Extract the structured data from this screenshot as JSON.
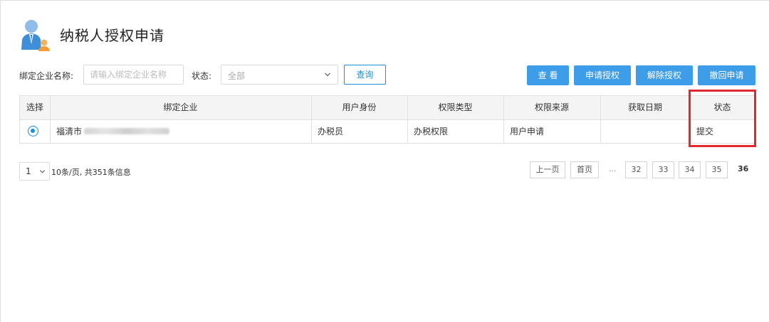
{
  "page": {
    "title": "纳税人授权申请",
    "avatar_icon": "user-avatar-icon"
  },
  "filters": {
    "company_label": "绑定企业名称:",
    "company_placeholder": "请输入绑定企业名称",
    "status_label": "状态:",
    "status_value": "全部",
    "query_button": "查询"
  },
  "actions": {
    "view": "查 看",
    "apply": "申请授权",
    "revoke_auth": "解除授权",
    "withdraw": "撤回申请"
  },
  "table": {
    "headers": [
      "选择",
      "绑定企业",
      "用户身份",
      "权限类型",
      "权限来源",
      "获取日期",
      "状态"
    ],
    "rows": [
      {
        "selected": true,
        "company": "福清市",
        "role": "办税员",
        "type": "办税权限",
        "source": "用户申请",
        "date": "",
        "status": "提交"
      }
    ]
  },
  "pagination": {
    "page_size": "1",
    "info": "10条/页, 共351条信息",
    "prev": "上一页",
    "first": "首页",
    "ellipsis": "...",
    "pages": [
      "32",
      "33",
      "34",
      "35"
    ],
    "current": "36"
  },
  "colors": {
    "accent": "#3e9de8",
    "highlight": "#e0282d",
    "radio": "#1a8ee0"
  }
}
